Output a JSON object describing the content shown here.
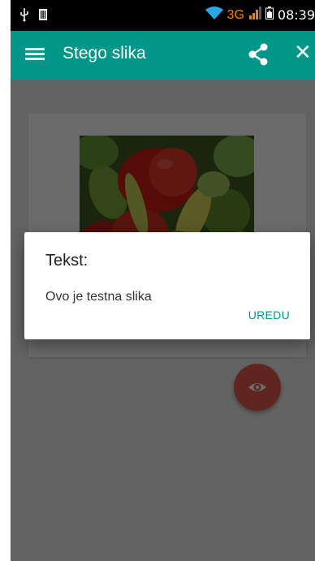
{
  "status_bar": {
    "left_icons": [
      "usb-icon",
      "sim-icon"
    ],
    "network": "3G",
    "time": "08:39"
  },
  "app_bar": {
    "title": "Stego slika",
    "menu_icon": "hamburger-menu-icon",
    "share_icon": "share-icon",
    "close_icon": "close-icon"
  },
  "image": {
    "description_icon": "pepper-photo"
  },
  "fab": {
    "icon": "eye-icon",
    "color": "#e85a4a"
  },
  "dialog": {
    "title": "Tekst:",
    "message": "Ovo je testna slika",
    "button": "UREDU"
  },
  "colors": {
    "primary": "#009688",
    "accent": "#e85a4a"
  }
}
